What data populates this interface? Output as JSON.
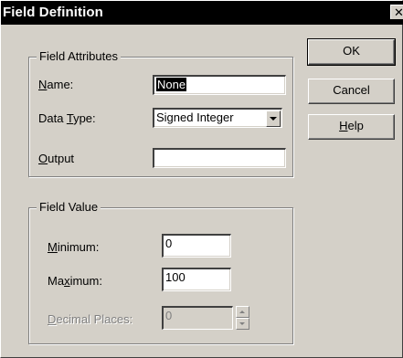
{
  "dialog": {
    "title": "Field Definition",
    "close_glyph": "✕",
    "buttons": {
      "ok_label": "OK",
      "cancel_label": "Cancel",
      "help_label": "Help"
    }
  },
  "attributes": {
    "group_label": "Field Attributes",
    "name_label": "Name:",
    "name_value": "None",
    "data_type_label": "Data Type:",
    "data_type_value": "Signed Integer",
    "output_label": "Output",
    "output_value": ""
  },
  "value": {
    "group_label": "Field Value",
    "minimum_label": "Minimum:",
    "minimum_value": "0",
    "maximum_label": "Maximum:",
    "maximum_value": "100",
    "decimal_places_label": "Decimal Places:",
    "decimal_places_value": "0"
  }
}
